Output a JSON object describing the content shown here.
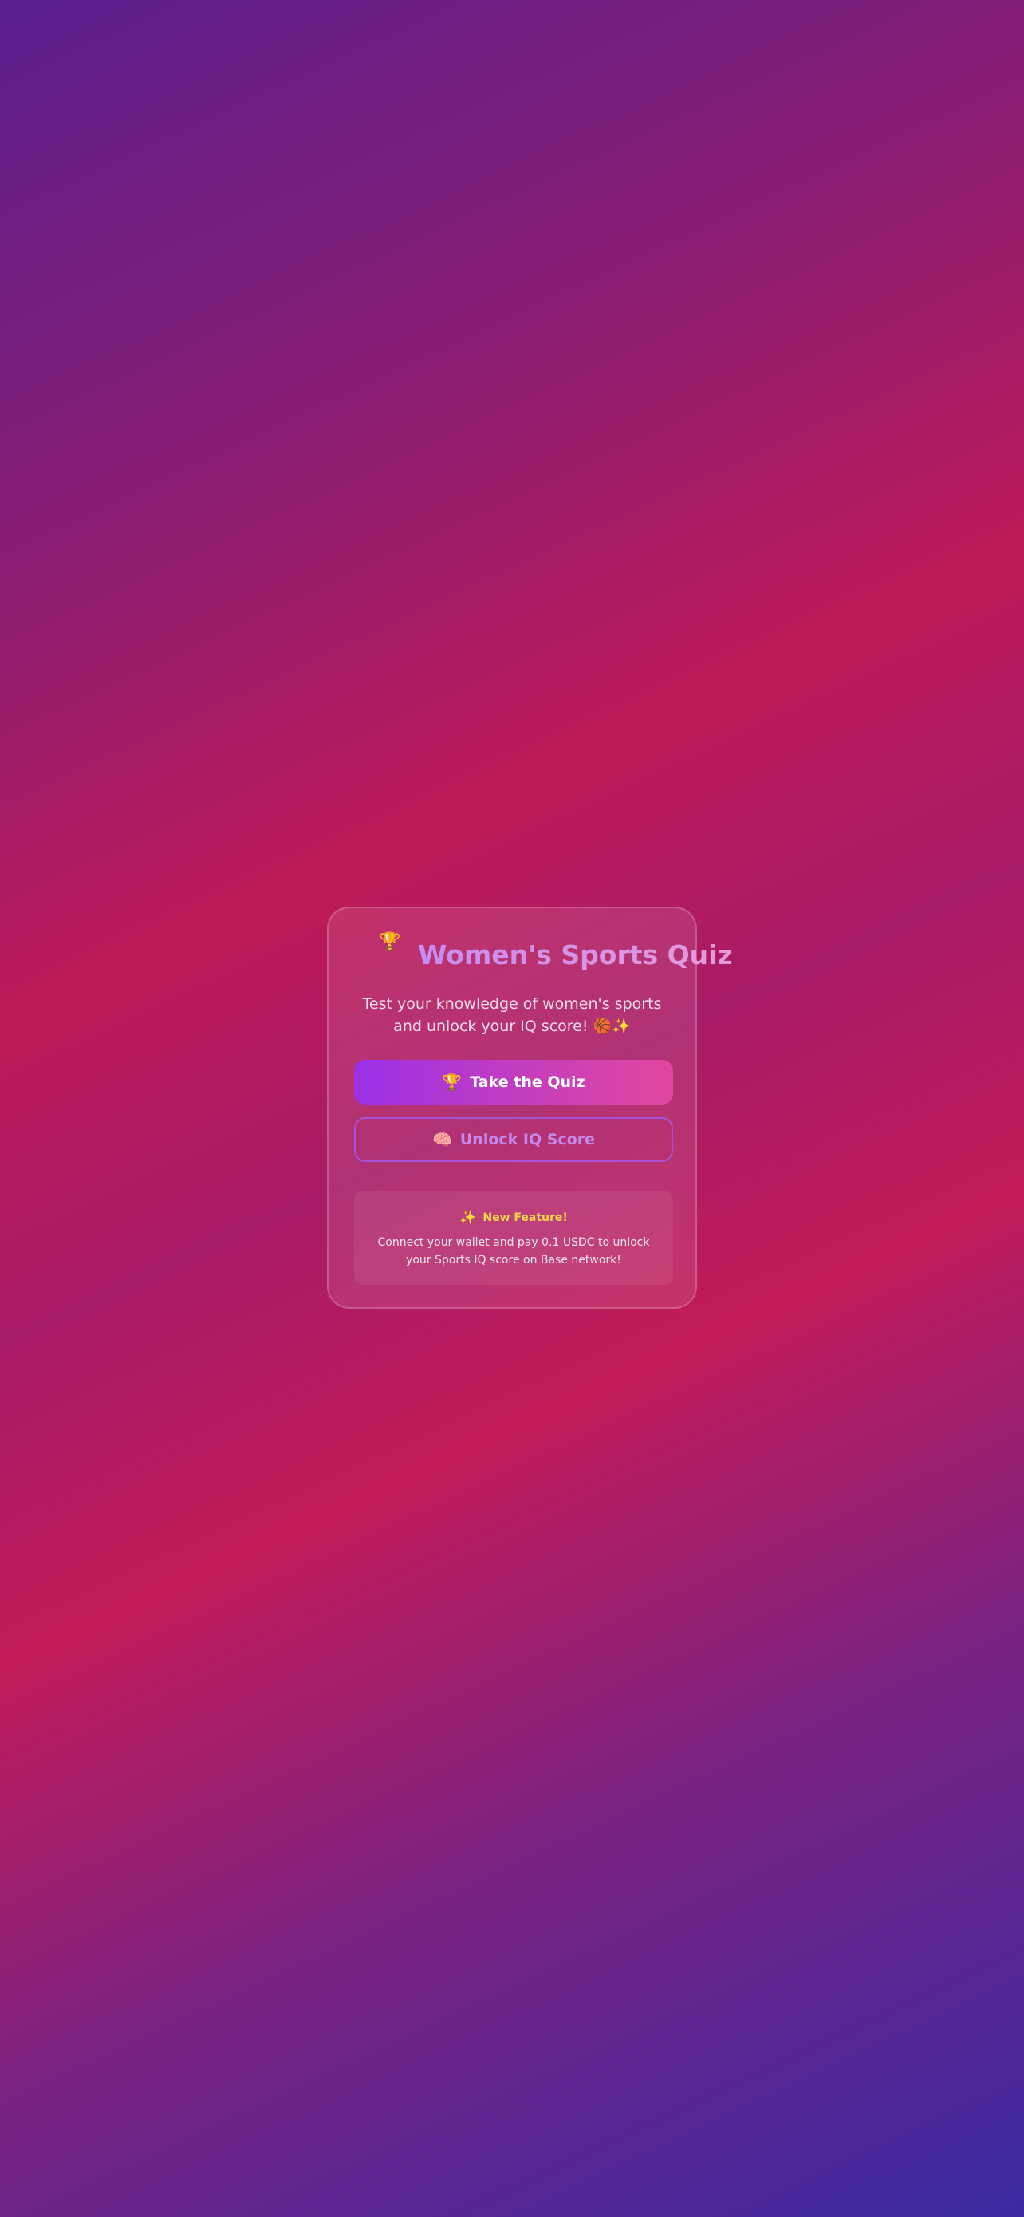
{
  "quiz": {
    "title_icon": "trophy-icon",
    "title": "Women's Sports Quiz",
    "subtitle": "Test your knowledge of women's sports and unlock your IQ score! 🏀✨",
    "primary_button": {
      "icon": "trophy-icon",
      "icon_glyph": "🏆",
      "label": "Take the Quiz"
    },
    "secondary_button": {
      "icon": "brain-icon",
      "icon_glyph": "🧠",
      "label": "Unlock IQ Score"
    },
    "feature": {
      "icon": "sparkles-icon",
      "icon_glyph": "✨",
      "title": "New Feature!",
      "text": "Connect your wallet and pay 0.1 USDC to unlock your Sports IQ score on Base network!"
    }
  },
  "colors": {
    "title_gradient_start": "#c58cf2",
    "primary_button_start": "#9a30e8",
    "primary_button_end": "#e2479e",
    "secondary_border": "#a752d8",
    "feature_title": "#f5d84a"
  }
}
